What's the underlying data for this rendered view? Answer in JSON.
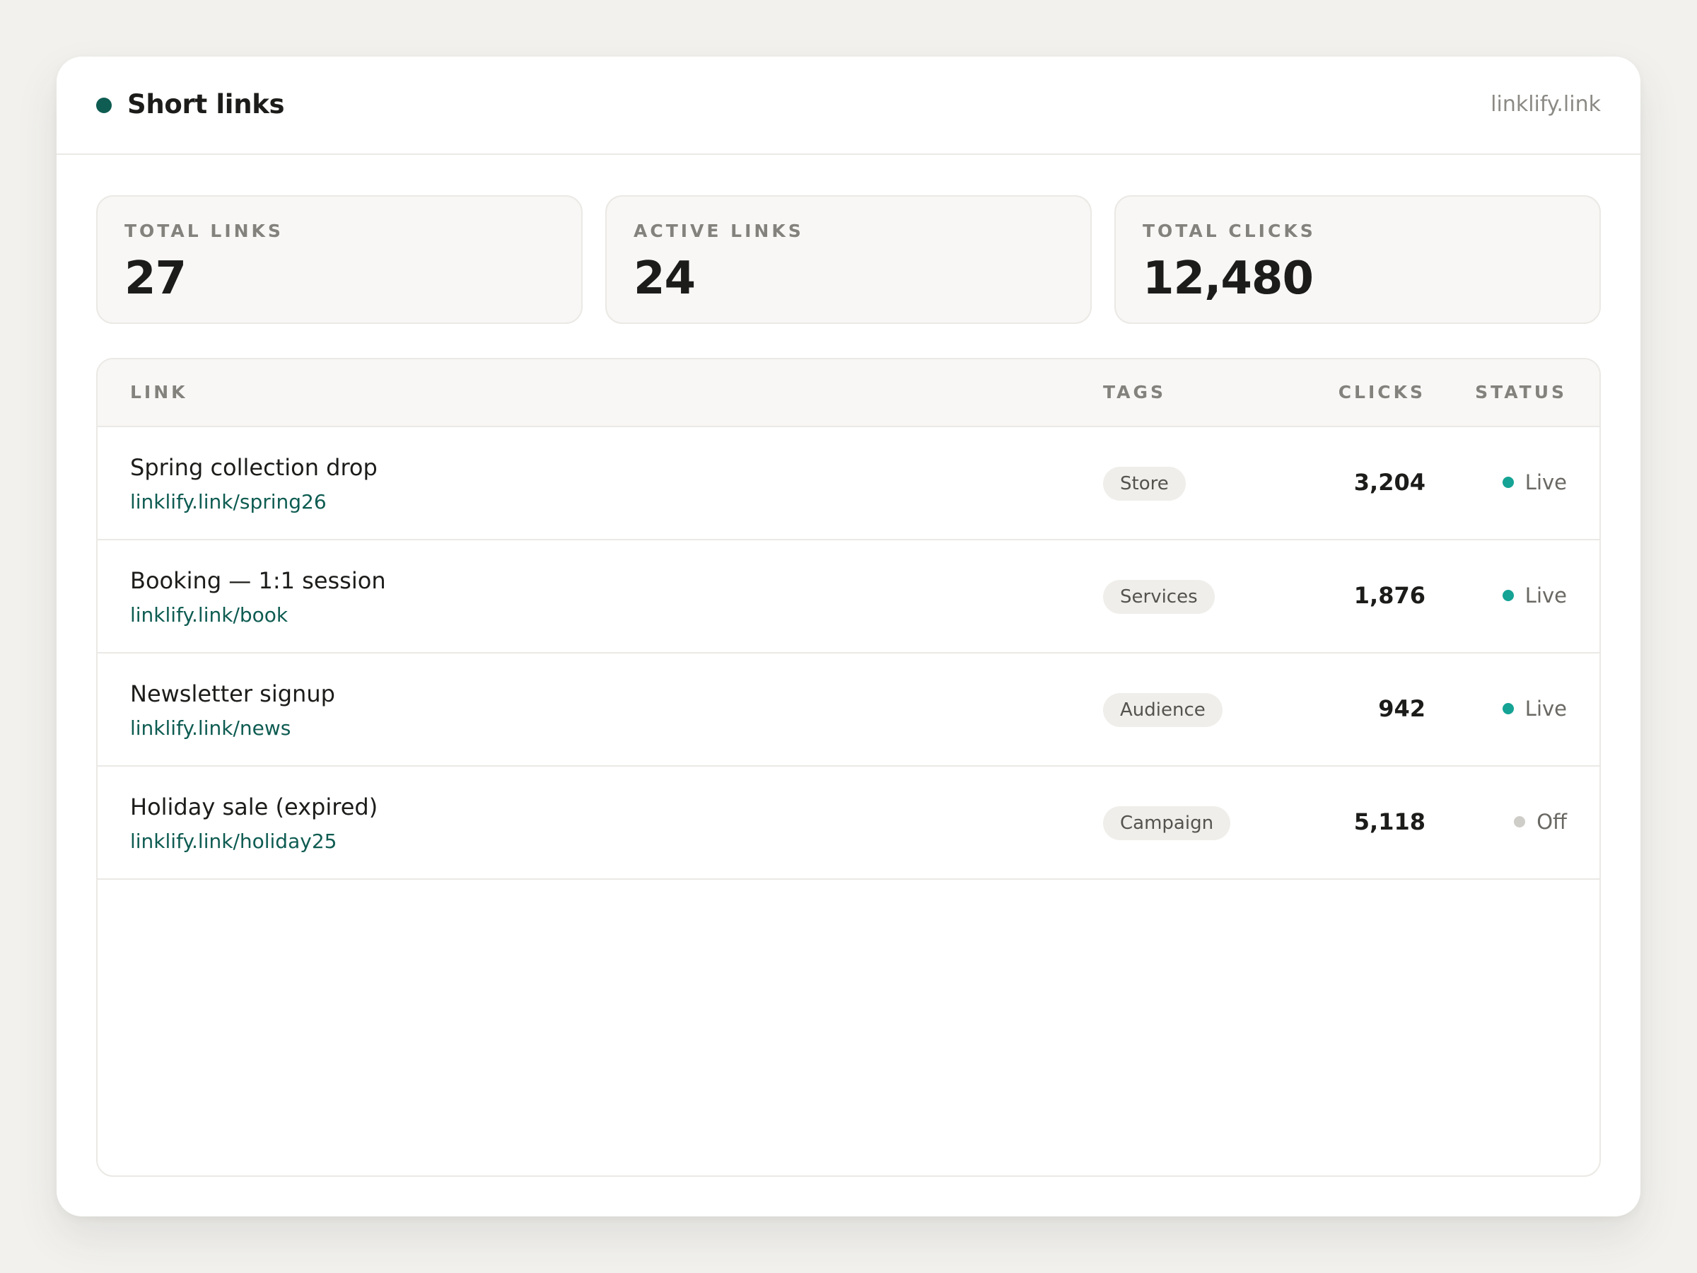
{
  "header": {
    "title": "Short links",
    "domain": "linklify.link",
    "brand_color": "#0e5c52"
  },
  "stats": [
    {
      "label": "TOTAL LINKS",
      "value": "27"
    },
    {
      "label": "ACTIVE LINKS",
      "value": "24"
    },
    {
      "label": "TOTAL CLICKS",
      "value": "12,480"
    }
  ],
  "table": {
    "columns": {
      "link": "LINK",
      "tags": "TAGS",
      "clicks": "CLICKS",
      "status": "STATUS"
    },
    "rows": [
      {
        "title": "Spring collection drop",
        "url": "linklify.link/spring26",
        "tag": "Store",
        "clicks": "3,204",
        "status": "Live",
        "status_color": "#14a394"
      },
      {
        "title": "Booking — 1:1 session",
        "url": "linklify.link/book",
        "tag": "Services",
        "clicks": "1,876",
        "status": "Live",
        "status_color": "#14a394"
      },
      {
        "title": "Newsletter signup",
        "url": "linklify.link/news",
        "tag": "Audience",
        "clicks": "942",
        "status": "Live",
        "status_color": "#14a394"
      },
      {
        "title": "Holiday sale (expired)",
        "url": "linklify.link/holiday25",
        "tag": "Campaign",
        "clicks": "5,118",
        "status": "Off",
        "status_color": "#cfcdc8"
      }
    ]
  }
}
